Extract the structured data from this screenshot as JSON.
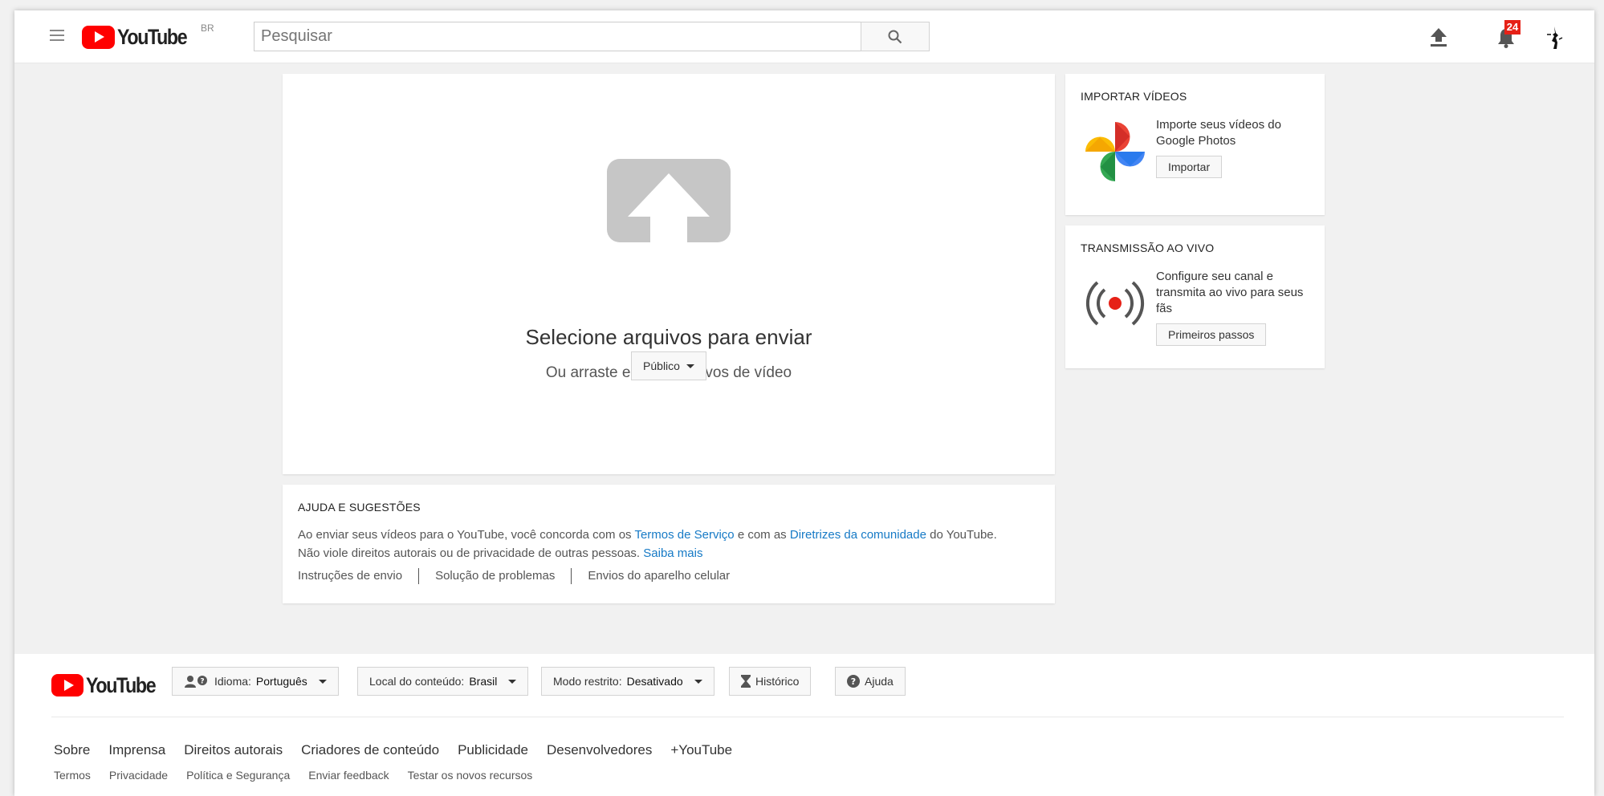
{
  "header": {
    "logo_text": "YouTube",
    "country_code": "BR",
    "search_placeholder": "Pesquisar",
    "notification_count": "24",
    "icons": [
      "menu-icon",
      "search-icon",
      "upload-icon",
      "bell-icon",
      "avatar"
    ]
  },
  "upload": {
    "title": "Selecione arquivos para enviar",
    "subtitle": "Ou arraste e solte arquivos de vídeo",
    "privacy_label": "Público"
  },
  "help": {
    "title": "AJUDA E SUGESTÕES",
    "text_1": "Ao enviar seus vídeos para o YouTube, você concorda com os ",
    "link_terms": "Termos de Serviço",
    "text_2": " e com as ",
    "link_guidelines": "Diretrizes da comunidade",
    "text_3": " do YouTube.",
    "text_4": "Não viole direitos autorais ou de privacidade de outras pessoas. ",
    "link_learn_more": "Saiba mais",
    "links": [
      "Instruções de envio",
      "Solução de problemas",
      "Envios do aparelho celular"
    ]
  },
  "import": {
    "title": "IMPORTAR VÍDEOS",
    "description": "Importe seus vídeos do Google Photos",
    "button": "Importar"
  },
  "live": {
    "title": "TRANSMISSÃO AO VIVO",
    "description": "Configure seu canal e transmita ao vivo para seus fãs",
    "button": "Primeiros passos"
  },
  "footer": {
    "logo_text": "YouTube",
    "language_label": "Idioma:",
    "language_value": "Português",
    "location_label": "Local do conteúdo:",
    "location_value": "Brasil",
    "restricted_label": "Modo restrito:",
    "restricted_value": "Desativado",
    "history": "Histórico",
    "help": "Ajuda",
    "primary_links": [
      "Sobre",
      "Imprensa",
      "Direitos autorais",
      "Criadores de conteúdo",
      "Publicidade",
      "Desenvolvedores",
      "+YouTube"
    ],
    "secondary_links": [
      "Termos",
      "Privacidade",
      "Política e Segurança",
      "Enviar feedback",
      "Testar os novos recursos"
    ]
  },
  "colors": {
    "brand_red": "#ff0000",
    "link_blue": "#167ac6",
    "badge_red": "#e62117",
    "upload_art_gray": "#c6c6c6"
  }
}
